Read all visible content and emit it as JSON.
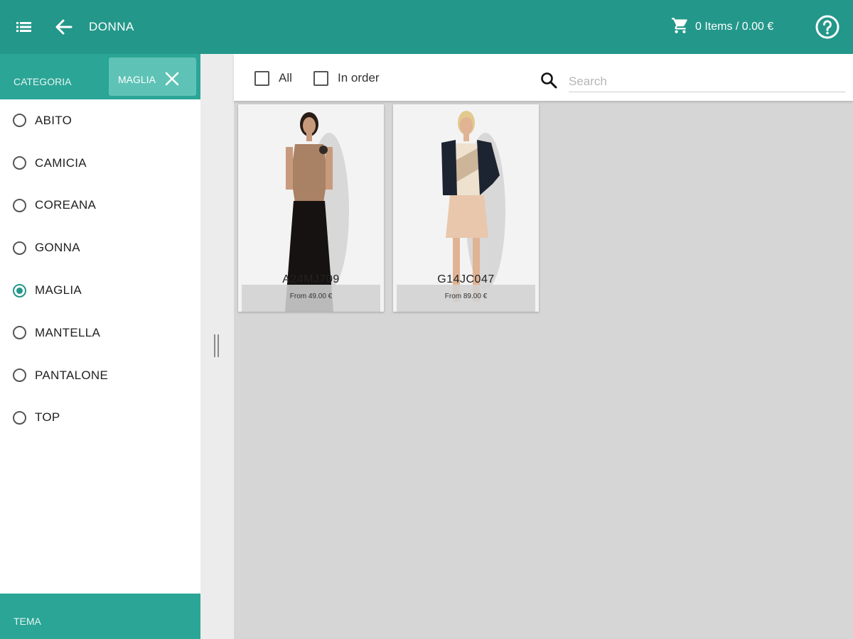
{
  "topbar": {
    "title": "DONNA",
    "cart_text": "0 Items / 0.00 €",
    "menu_icon": "list-menu-icon",
    "back_icon": "arrow-left-icon",
    "cart_icon": "shopping-cart-icon",
    "help_icon": "help-circle-icon"
  },
  "sidebar": {
    "header_label": "CATEGORIA",
    "active_filter": "MAGLIA",
    "categories": [
      {
        "label": "ABITO",
        "selected": false
      },
      {
        "label": "CAMICIA",
        "selected": false
      },
      {
        "label": "COREANA",
        "selected": false
      },
      {
        "label": "GONNA",
        "selected": false
      },
      {
        "label": "MAGLIA",
        "selected": true
      },
      {
        "label": "MANTELLA",
        "selected": false
      },
      {
        "label": "PANTALONE",
        "selected": false
      },
      {
        "label": "TOP",
        "selected": false
      }
    ],
    "footer_label": "TEMA"
  },
  "filterbar": {
    "all_label": "All",
    "in_order_label": "In order",
    "search_placeholder": "Search"
  },
  "products": [
    {
      "code": "A24MJ709",
      "price": "From 49.00 €"
    },
    {
      "code": "G14JC047",
      "price": "From 89.00 €"
    }
  ],
  "colors": {
    "primary": "#23978a",
    "sidebar_header": "#2aa596",
    "chip": "#5ec3b6",
    "content_bg": "#d6d6d6"
  }
}
